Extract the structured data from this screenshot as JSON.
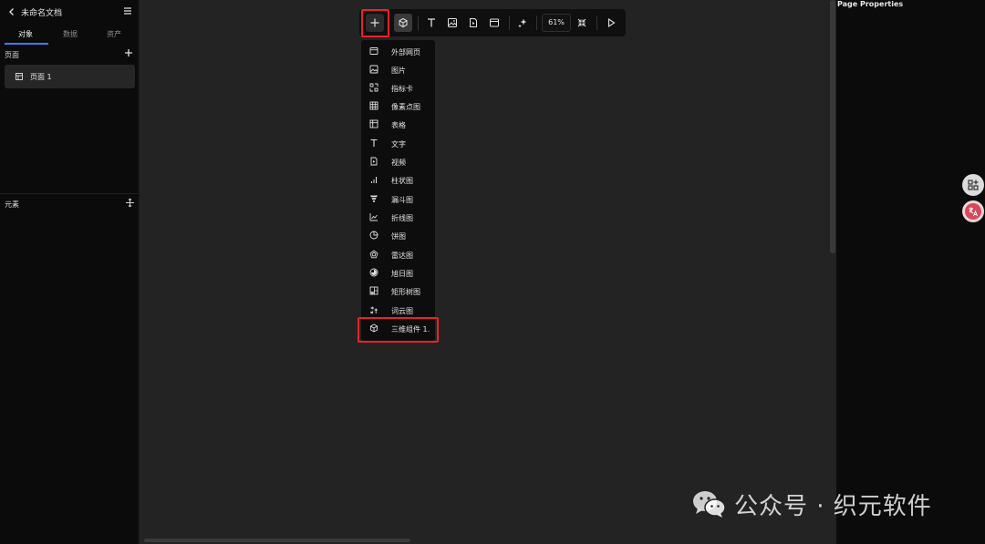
{
  "left_panel": {
    "doc_title": "未命名文档",
    "tabs": [
      {
        "label": "对象"
      },
      {
        "label": "数据"
      },
      {
        "label": "资产"
      }
    ],
    "pages_label": "页面",
    "pages": [
      {
        "label": "页面 1"
      }
    ],
    "elements_label": "元素"
  },
  "right_panel": {
    "title": "Page Properties"
  },
  "toolbar": {
    "zoom": "61%",
    "buttons": [
      "plus-icon",
      "cube-icon",
      "text-icon",
      "image-icon",
      "video-icon",
      "window-icon",
      "sparkle-icon",
      "fit-screen-icon",
      "play-icon"
    ]
  },
  "insert_menu": {
    "items": [
      {
        "label": "外部网页",
        "icon": "webpage-icon"
      },
      {
        "label": "图片",
        "icon": "image-icon"
      },
      {
        "label": "指标卡",
        "icon": "metric-card-icon"
      },
      {
        "label": "像素点图",
        "icon": "pixel-grid-icon"
      },
      {
        "label": "表格",
        "icon": "table-icon"
      },
      {
        "label": "文字",
        "icon": "text-icon"
      },
      {
        "label": "视频",
        "icon": "video-icon"
      },
      {
        "label": "柱状图",
        "icon": "bar-chart-icon"
      },
      {
        "label": "漏斗图",
        "icon": "funnel-icon"
      },
      {
        "label": "折线图",
        "icon": "line-chart-icon"
      },
      {
        "label": "饼图",
        "icon": "pie-chart-icon"
      },
      {
        "label": "雷达图",
        "icon": "radar-chart-icon"
      },
      {
        "label": "旭日图",
        "icon": "sunburst-icon"
      },
      {
        "label": "矩形树图",
        "icon": "treemap-icon"
      },
      {
        "label": "词云图",
        "icon": "word-cloud-icon"
      },
      {
        "label": "三维组件 1.",
        "icon": "cube-icon"
      }
    ]
  },
  "watermark": {
    "text": "公众号 · 织元软件"
  },
  "colors": {
    "accent": "#3d7bf7",
    "highlight": "#e8232a",
    "canvas": "#232323",
    "panel": "#0b0b0c"
  }
}
